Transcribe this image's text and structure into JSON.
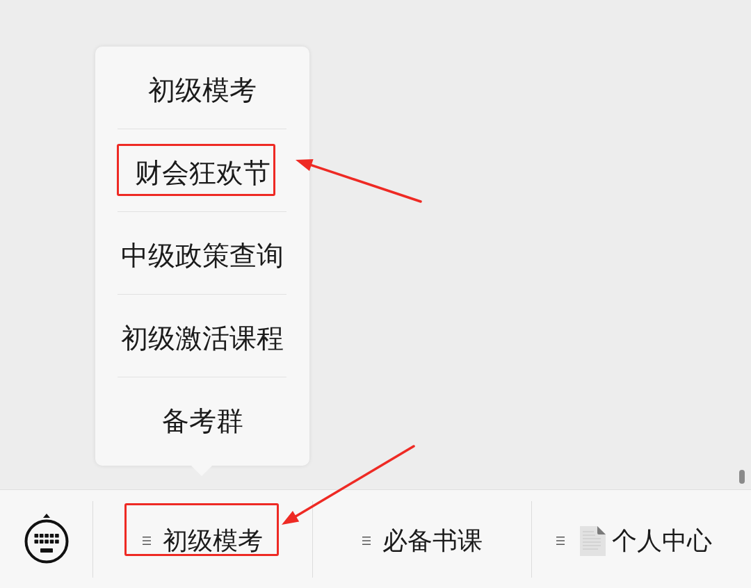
{
  "popup_menu": {
    "items": [
      {
        "label": "初级模考",
        "highlighted": false
      },
      {
        "label": "财会狂欢节",
        "highlighted": true
      },
      {
        "label": "中级政策查询",
        "highlighted": false
      },
      {
        "label": "初级激活课程",
        "highlighted": false
      },
      {
        "label": "备考群",
        "highlighted": false
      }
    ]
  },
  "bottom_bar": {
    "tabs": [
      {
        "kind": "text",
        "label": "初级模考",
        "highlighted": true
      },
      {
        "kind": "text",
        "label": "必备书课",
        "highlighted": false
      },
      {
        "kind": "icon_text",
        "label": "个人中心",
        "highlighted": false
      }
    ]
  }
}
